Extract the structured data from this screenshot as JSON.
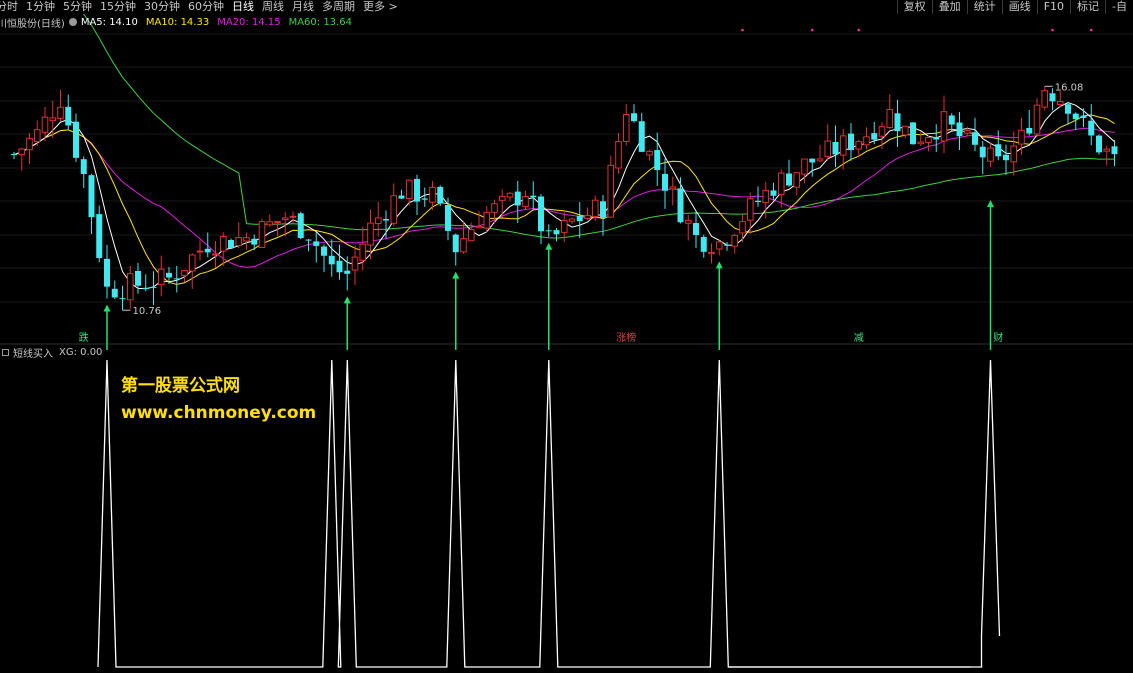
{
  "toolbar": {
    "periods": [
      "分时",
      "1分钟",
      "5分钟",
      "15分钟",
      "30分钟",
      "60分钟",
      "日线",
      "周线",
      "月线",
      "多周期",
      "更多 >"
    ],
    "active_period": "日线",
    "right_tools": [
      "复权",
      "叠加",
      "统计",
      "画线",
      "F10",
      "标记",
      "-自"
    ]
  },
  "legend": {
    "stock_name": "川恒股份(日线)",
    "ma5": "MA5: 14.10",
    "ma10": "MA10: 14.33",
    "ma20": "MA20: 14.15",
    "ma60": "MA60: 13.64",
    "colors": {
      "ma5": "#ffffff",
      "ma10": "#ffe600",
      "ma20": "#e020e0",
      "ma60": "#40d040"
    }
  },
  "indicator": {
    "name": "短线买入",
    "value": "XG: 0.00"
  },
  "watermark": {
    "title": "第一股票公式网",
    "url": "www.chnmoney.com",
    "color": "#ffe000"
  },
  "chart_data": {
    "type": "candlestick",
    "period": "daily",
    "price_high_label": "16.08",
    "price_low_label": "10.76",
    "colors": {
      "up": "#e03030",
      "down": "#40e8f0",
      "buy_arrow": "#20e070",
      "signal": "#ffffff"
    },
    "buy_signals_candle_index": [
      12,
      43,
      57,
      69,
      91,
      126
    ],
    "indicator_spike_candle_index": [
      12,
      41,
      43,
      57,
      69,
      91,
      126
    ],
    "event_markers": [
      {
        "label": "跌",
        "candle_index": 9
      },
      {
        "label": "涨榜",
        "candle_index": 79
      },
      {
        "label": "减",
        "candle_index": 109
      },
      {
        "label": "财",
        "candle_index": 127
      }
    ]
  }
}
